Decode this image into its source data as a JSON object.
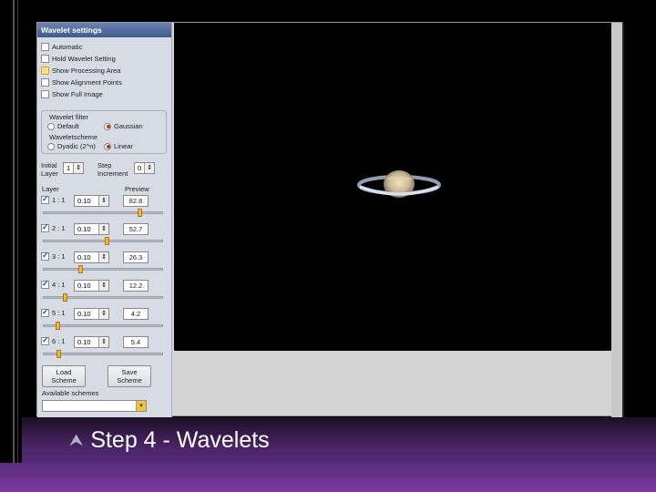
{
  "panel": {
    "title": "Wavelet settings",
    "checkboxes": [
      {
        "label": "Automatic",
        "checked": false
      },
      {
        "label": "Hold Wavelet Setting",
        "checked": false
      },
      {
        "label": "Show Processing Area",
        "checked": false,
        "highlight": true
      },
      {
        "label": "Show Alignment Points",
        "checked": false
      },
      {
        "label": "Show Full Image",
        "checked": false
      }
    ],
    "wavelet_filter_label": "Wavelet filter",
    "filter_options": [
      "Default",
      "Gaussian"
    ],
    "filter_selected": "Gaussian",
    "wavelet_scheme_label": "Waveletscheme",
    "scheme_options": [
      "Dyadic (2^n)",
      "Linear"
    ],
    "scheme_selected": "Linear",
    "initial_layer_label": "Initial Layer",
    "initial_layer_value": "1",
    "step_increment_label": "Step Increment",
    "step_increment_value": "0",
    "layer_header": "Layer",
    "preview_header": "Preview",
    "layers": [
      {
        "name": "1 : 1",
        "checked": true,
        "value": "0.10",
        "preview": "82.8",
        "slider": 0.82
      },
      {
        "name": "2 : 1",
        "checked": true,
        "value": "0.10",
        "preview": "52.7",
        "slider": 0.53
      },
      {
        "name": "3 : 1",
        "checked": true,
        "value": "0.10",
        "preview": "26.3",
        "slider": 0.3
      },
      {
        "name": "4 : 1",
        "checked": true,
        "value": "0.10",
        "preview": "12.2",
        "slider": 0.17
      },
      {
        "name": "5 : 1",
        "checked": true,
        "value": "0.10",
        "preview": "4.2",
        "slider": 0.1
      },
      {
        "name": "6 : 1",
        "checked": true,
        "value": "0.10",
        "preview": "5.4",
        "slider": 0.11
      }
    ],
    "load_scheme_label": [
      "Load",
      "Scheme"
    ],
    "save_scheme_label": [
      "Save",
      "Scheme"
    ],
    "available_schemes_label": "Available schemes",
    "available_schemes_value": ""
  },
  "caption": {
    "text": "Step 4 - Wavelets"
  },
  "colors": {
    "accent_orange": "#f3b53c",
    "purple_band": "#6b3590"
  }
}
